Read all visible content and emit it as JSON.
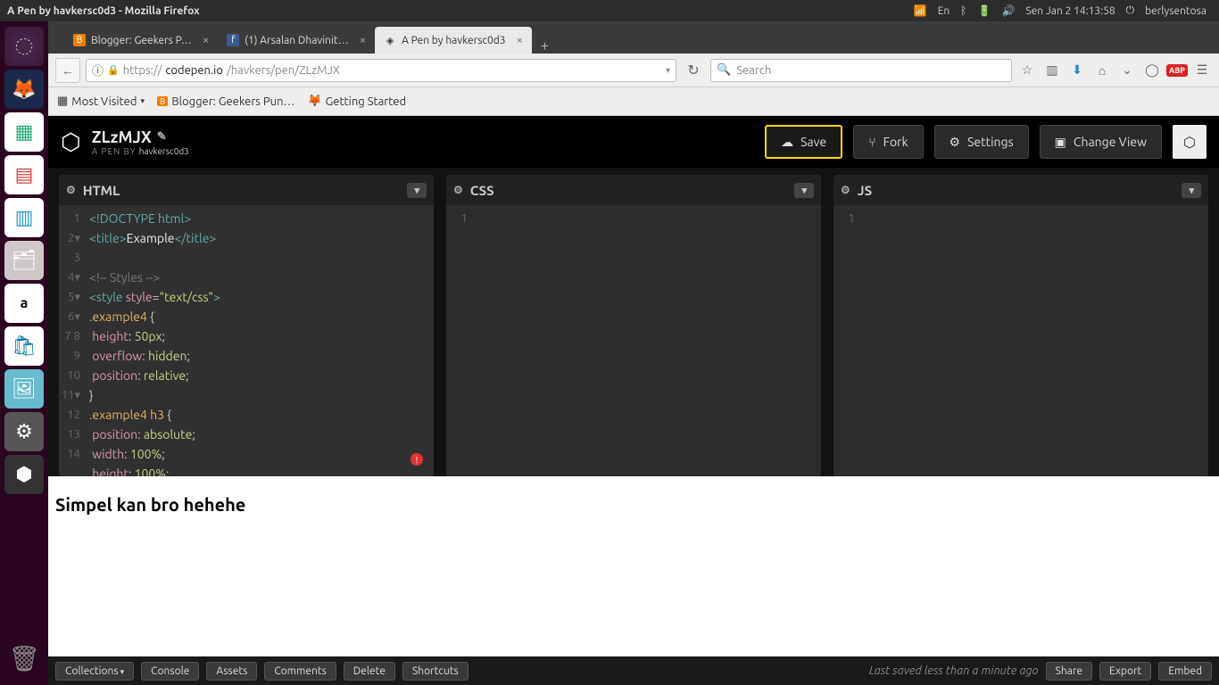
{
  "system": {
    "window_title": "A Pen by havkersc0d3 - Mozilla Firefox",
    "date": "Sen Jan  2 14:13:58",
    "user": "berlysentosa",
    "lang": "En"
  },
  "firefox": {
    "tabs": [
      {
        "label": "Blogger: Geekers P…",
        "favicon": "B",
        "favcolor": "#f57c00"
      },
      {
        "label": "(1) Arsalan Dhavinit…",
        "favicon": "f",
        "favcolor": "#3b5998"
      },
      {
        "label": "A Pen by havkersc0d3",
        "favicon": "◈",
        "favcolor": "#444"
      }
    ],
    "url_prefix": "https://",
    "url_domain": "codepen.io",
    "url_path": "/havkers/pen/ZLzMJX",
    "search_placeholder": "Search",
    "bookmarks": [
      {
        "label": "Most Visited",
        "icon": "▦",
        "dd": true
      },
      {
        "label": "Blogger: Geekers Pun…",
        "icon": "B"
      },
      {
        "label": "Getting Started",
        "icon": "🦊"
      }
    ]
  },
  "codepen": {
    "title": "ZLzMJX",
    "sub_prefix": "A PEN BY ",
    "author": "havkersc0d3",
    "buttons": {
      "save": "Save",
      "fork": "Fork",
      "settings": "Settings",
      "changeview": "Change View"
    },
    "panels": {
      "html": "HTML",
      "css": "CSS",
      "js": "JS"
    },
    "html_lines": [
      "1",
      "2",
      "3",
      "4",
      "5",
      "6",
      "7",
      "8",
      "9",
      "10",
      "11",
      "12",
      "13",
      "14"
    ],
    "css_line": "1",
    "js_line": "1",
    "output_text": "Simpel kan bro hehehe",
    "footer": {
      "collections": "Collections",
      "console": "Console",
      "assets": "Assets",
      "comments": "Comments",
      "delete": "Delete",
      "shortcuts": "Shortcuts",
      "status": "Last saved less than a minute ago",
      "share": "Share",
      "export": "Export",
      "embed": "Embed"
    }
  }
}
